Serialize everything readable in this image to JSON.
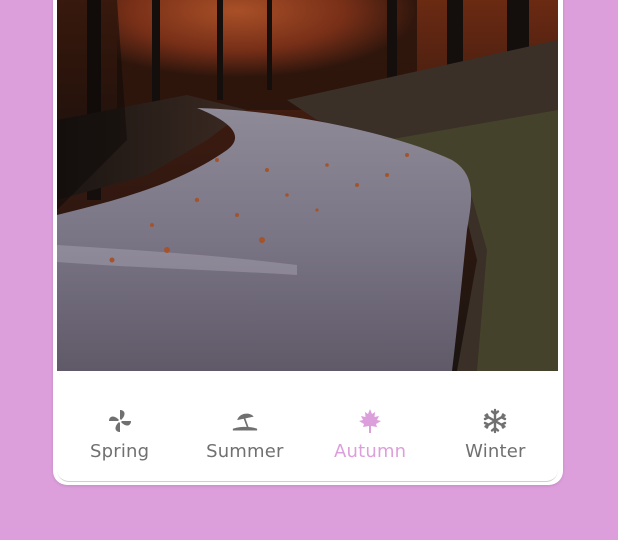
{
  "colors": {
    "background": "#dd9fdc",
    "accent": "#dd9fdc",
    "inactive": "#707070"
  },
  "photo": {
    "subject": "winding road through autumn forest"
  },
  "tabs": [
    {
      "label": "Spring",
      "icon": "pinwheel-icon",
      "active": false
    },
    {
      "label": "Summer",
      "icon": "beach-umbrella-icon",
      "active": false
    },
    {
      "label": "Autumn",
      "icon": "maple-leaf-icon",
      "active": true
    },
    {
      "label": "Winter",
      "icon": "snowflake-icon",
      "active": false
    }
  ]
}
